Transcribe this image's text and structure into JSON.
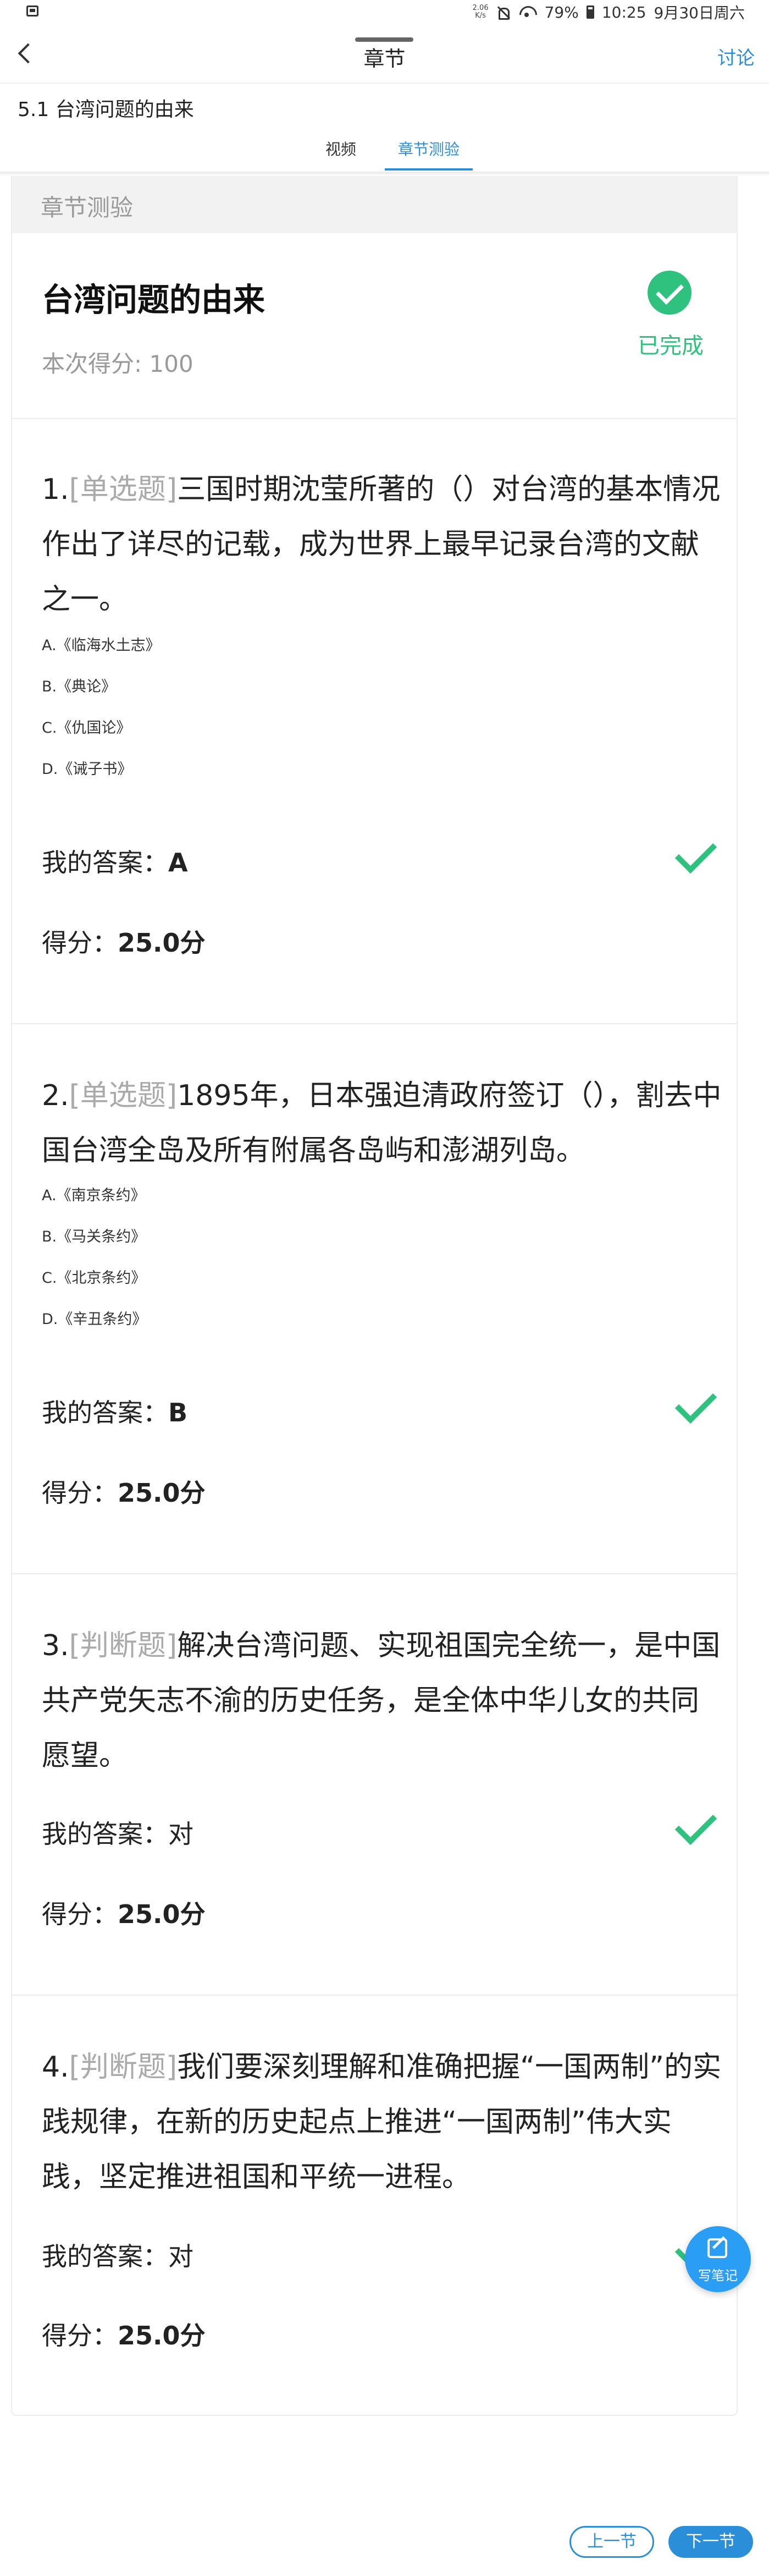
{
  "status_bar": {
    "net_speed_value": "2.06",
    "net_speed_unit": "K/s",
    "battery": "79%",
    "time": "10:25",
    "date": "9月30日周六"
  },
  "header": {
    "title": "章节",
    "discuss_label": "讨论"
  },
  "section_title": "5.1 台湾问题的由来",
  "tabs": [
    {
      "label": "视频"
    },
    {
      "label": "章节测验"
    }
  ],
  "quiz": {
    "header_label": "章节测验",
    "title": "台湾问题的由来",
    "score_text": "本次得分: 100",
    "status": "已完成",
    "answer_label": "我的答案：",
    "score_label": "得分：",
    "questions": [
      {
        "number": "1.",
        "type": "[单选题]",
        "text": "三国时期沈莹所著的（）对台湾的基本情况作出了详尽的记载，成为世界上最早记录台湾的文献之一。",
        "options": [
          "A.《临海水土志》",
          "B.《典论》",
          "C.《仇国论》",
          "D.《诫子书》"
        ],
        "answer": "A",
        "score": "25.0分"
      },
      {
        "number": "2.",
        "type": "[单选题]",
        "text": "1895年，日本强迫清政府签订（），割去中国台湾全岛及所有附属各岛屿和澎湖列岛。",
        "options": [
          "A.《南京条约》",
          "B.《马关条约》",
          "C.《北京条约》",
          "D.《辛丑条约》"
        ],
        "answer": "B",
        "score": "25.0分"
      },
      {
        "number": "3.",
        "type": "[判断题]",
        "text": "解决台湾问题、实现祖国完全统一，是中国共产党矢志不渝的历史任务，是全体中华儿女的共同愿望。",
        "answer": "对",
        "score": "25.0分"
      },
      {
        "number": "4.",
        "type": "[判断题]",
        "text": "我们要深刻理解和准确把握“一国两制”的实践规律，在新的历史起点上推进“一国两制”伟大实践，坚定推进祖国和平统一进程。",
        "answer": "对",
        "score": "25.0分"
      }
    ]
  },
  "note_button": {
    "label": "写笔记"
  },
  "nav": {
    "prev_label": "上一节",
    "next_label": "下一节"
  },
  "colors": {
    "accent": "#2a8fd8",
    "success": "#2ec27e",
    "muted": "#999999"
  }
}
